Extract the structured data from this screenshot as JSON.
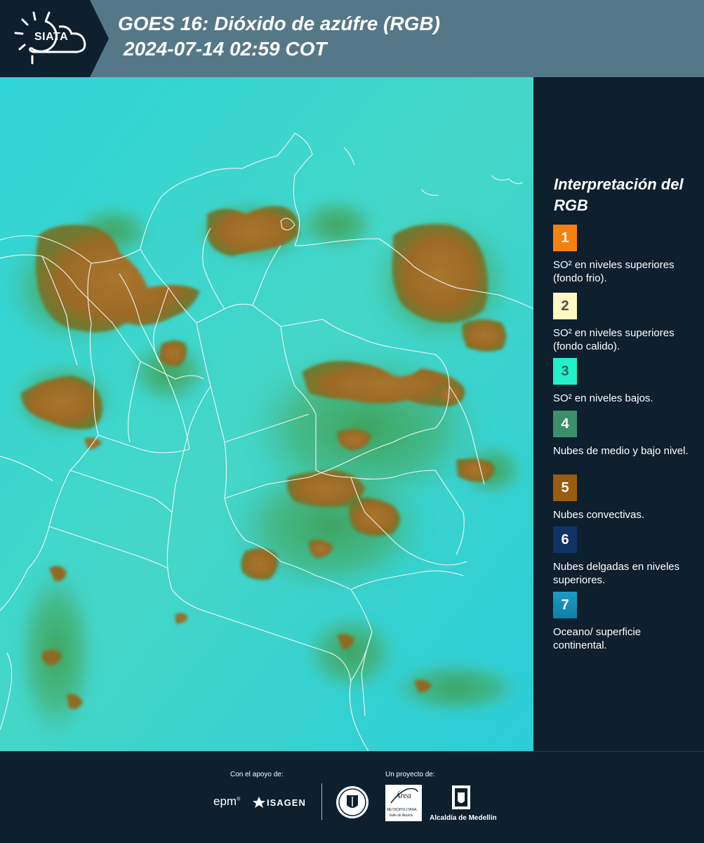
{
  "header": {
    "logo_text": "SIATA",
    "title_line1": "GOES 16: Dióxido de azúfre (RGB)",
    "title_line2": "2024-07-14 02:59 COT"
  },
  "legend": {
    "title": "Interpretación del RGB",
    "items": [
      {
        "number": "1",
        "color": "#f5820f",
        "text_color": "#ffffff",
        "label": "SO² en niveles superiores (fondo frio)."
      },
      {
        "number": "2",
        "color": "#fff7c2",
        "text_color": "#4b4b4b",
        "label": "SO² en niveles superiores (fondo calido)."
      },
      {
        "number": "3",
        "color": "#22f0c8",
        "text_color": "#3b5b5b",
        "label": "SO² en niveles bajos."
      },
      {
        "number": "4",
        "color": "#3b8f6a",
        "text_color": "#ffffff",
        "label": "Nubes de medio y bajo nivel."
      },
      {
        "number": "5",
        "color": "#9a5c12",
        "text_color": "#ffffff",
        "label": "Nubes convectivas."
      },
      {
        "number": "6",
        "color": "#0f3365",
        "text_color": "#ffffff",
        "label": "Nubes delgadas en niveles superiores."
      },
      {
        "number": "7",
        "color": "#178fb6",
        "text_color": "#ffffff",
        "label": "Oceano/ superficie continental."
      }
    ]
  },
  "footer": {
    "support_label": "Con el apoyo de:",
    "project_label": "Un proyecto de:",
    "epm": "epm",
    "isagen": "ISAGEN",
    "area_name": "Área",
    "area_sub1": "METROPOLITANA",
    "area_sub2": "Valle de Aburrá",
    "alcaldia": "Alcaldía de Medellín"
  },
  "colors": {
    "header_bg": "#557888",
    "panel_bg": "#0e1f2d",
    "ocean": "#2ad0d8",
    "convective": "#9a6a28",
    "mid_cloud": "#3e9a5a"
  }
}
